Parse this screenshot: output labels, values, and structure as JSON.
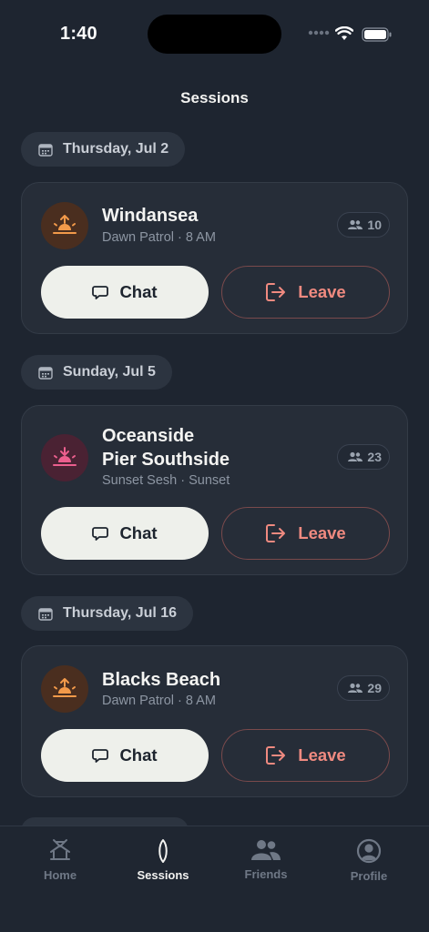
{
  "status_bar": {
    "time": "1:40"
  },
  "header": {
    "title": "Sessions"
  },
  "groups": [
    {
      "date": "Thursday, Jul 2",
      "session": {
        "spot": "Windansea",
        "spot_line2": "",
        "meta": "Dawn Patrol · 8 AM",
        "count": "10",
        "icon": "sunrise-icon",
        "accent": "#f39a4a"
      }
    },
    {
      "date": "Sunday, Jul 5",
      "session": {
        "spot": "Oceanside",
        "spot_line2": "Pier Southside",
        "meta": "Sunset Sesh · Sunset",
        "count": "23",
        "icon": "sunset-icon",
        "accent": "#ec5f8e"
      }
    },
    {
      "date": "Thursday, Jul 16",
      "session": {
        "spot": "Blacks Beach",
        "spot_line2": "",
        "meta": "Dawn Patrol · 8 AM",
        "count": "29",
        "icon": "sunrise-icon",
        "accent": "#f39a4a"
      }
    }
  ],
  "actions": {
    "chat_label": "Chat",
    "leave_label": "Leave"
  },
  "tabs": [
    {
      "label": "Home",
      "icon": "home-icon",
      "active": false
    },
    {
      "label": "Sessions",
      "icon": "surfboard-icon",
      "active": true
    },
    {
      "label": "Friends",
      "icon": "friends-icon",
      "active": false
    },
    {
      "label": "Profile",
      "icon": "profile-icon",
      "active": false
    }
  ],
  "colors": {
    "background": "#1e2530",
    "card": "#262d38",
    "chat_button": "#eef0eb",
    "leave_accent": "#f08a80"
  }
}
